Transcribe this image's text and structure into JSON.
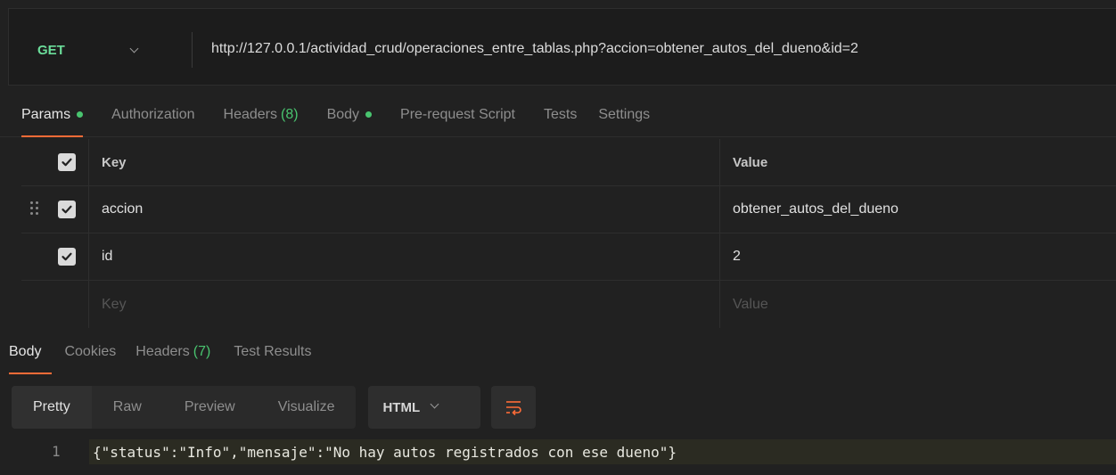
{
  "request": {
    "method": "GET",
    "url": "http://127.0.0.1/actividad_crud/operaciones_entre_tablas.php?accion=obtener_autos_del_dueno&id=2"
  },
  "request_tabs": {
    "params": "Params",
    "authorization": "Authorization",
    "headers": "Headers",
    "headers_count": "(8)",
    "body": "Body",
    "prerequest": "Pre-request Script",
    "tests": "Tests",
    "settings": "Settings"
  },
  "params": {
    "header_key": "Key",
    "header_value": "Value",
    "rows": [
      {
        "key": "accion",
        "value": "obtener_autos_del_dueno"
      },
      {
        "key": "id",
        "value": "2"
      }
    ],
    "placeholder_key": "Key",
    "placeholder_value": "Value"
  },
  "response_tabs": {
    "body": "Body",
    "cookies": "Cookies",
    "headers": "Headers",
    "headers_count": "(7)",
    "test_results": "Test Results"
  },
  "viewer": {
    "modes": [
      "Pretty",
      "Raw",
      "Preview",
      "Visualize"
    ],
    "format": "HTML"
  },
  "response_body": {
    "line_number": "1",
    "line": "{\"status\":\"Info\",\"mensaje\":\"No hay autos registrados con ese dueno\"}"
  },
  "colors": {
    "accent": "#ff6c37",
    "method_get": "#6bdd9a",
    "status_dot": "#49c46f"
  },
  "icons": [
    "chevron-down-icon",
    "checkbox-checked-icon",
    "drag-handle-icon",
    "word-wrap-icon"
  ]
}
